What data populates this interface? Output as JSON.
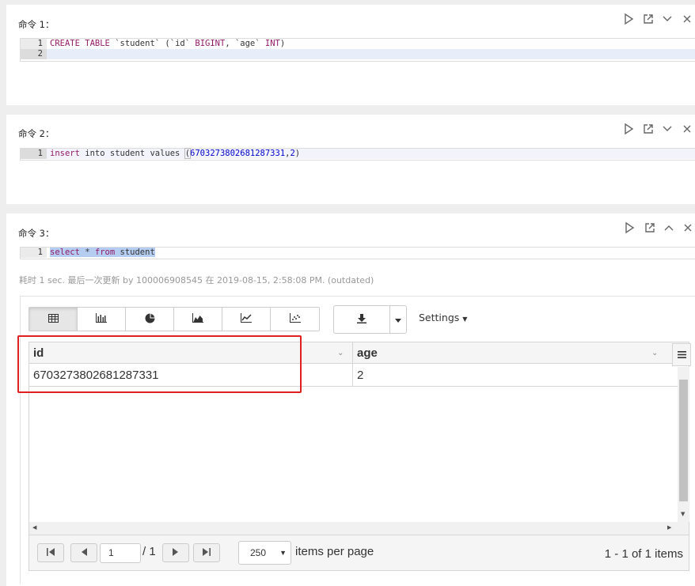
{
  "cells": [
    {
      "title": "命令 1：",
      "lines": [
        {
          "number": "1",
          "code": "CREATE TABLE `student` (`id` BIGINT, `age` INT)"
        },
        {
          "number": "2",
          "code": ""
        }
      ]
    },
    {
      "title": "命令 2：",
      "lines": [
        {
          "number": "1",
          "code": "insert into student values (6703273802681287331,2)"
        }
      ]
    },
    {
      "title": "命令 3：",
      "lines": [
        {
          "number": "1",
          "code": "select * from student"
        }
      ],
      "status": "耗时 1 sec. 最后一次更新 by 100006908545 在 2019-08-15, 2:58:08 PM. (outdated)"
    }
  ],
  "toolbar_icons": [
    "run-icon",
    "open-external-icon",
    "collapse-icon",
    "close-icon"
  ],
  "result": {
    "viz_buttons": [
      {
        "icon": "table-icon",
        "active": true
      },
      {
        "icon": "bar-chart-icon",
        "active": false
      },
      {
        "icon": "pie-chart-icon",
        "active": false
      },
      {
        "icon": "area-chart-icon",
        "active": false
      },
      {
        "icon": "line-chart-icon",
        "active": false
      },
      {
        "icon": "scatter-chart-icon",
        "active": false
      }
    ],
    "settings_label": "Settings",
    "columns": [
      "id",
      "age"
    ],
    "rows": [
      [
        "6703273802681287331",
        "2"
      ]
    ],
    "pager": {
      "current_page": "1",
      "total_pages": "/ 1",
      "page_size": "250",
      "per_page_label": "items per page",
      "info": "1 - 1 of 1 items"
    }
  },
  "colors": {
    "highlight": "#e02020",
    "keyword": "#931a68",
    "number": "#0000cd",
    "selection": "#b5cdf0"
  }
}
